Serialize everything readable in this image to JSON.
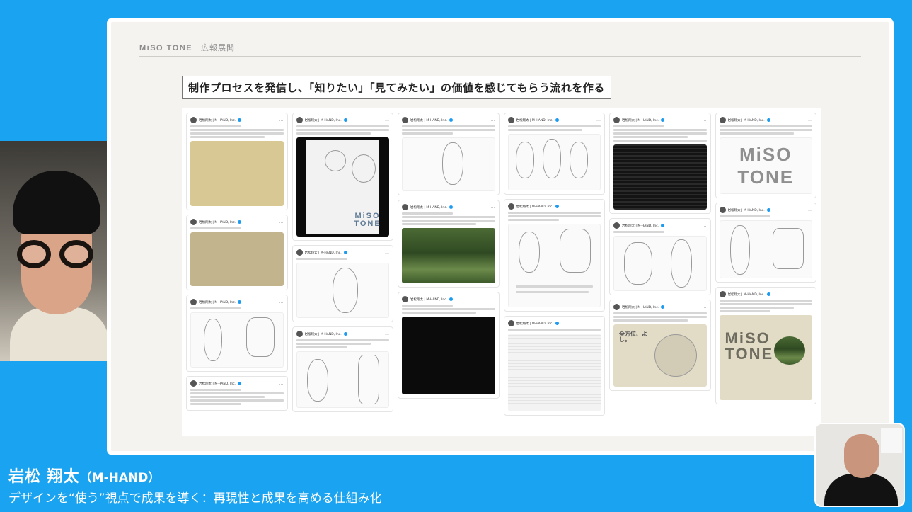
{
  "slide": {
    "brand": "MiSO TONE",
    "section": "広報展開",
    "title": "制作プロセスを発信し、「知りたい」「見てみたい」の価値を感じてもらう流れを作る"
  },
  "posts": {
    "author": "岩松翔太 | M-HAND, Inc.",
    "wordmark_1": "MiSO TONE",
    "wordmark_2": "MiSO",
    "wordmark_3": "TONE",
    "poster_word": "MiSO TONE",
    "poster_note": "全方位、よし。"
  },
  "speaker": {
    "name": "岩松 翔太",
    "org": "（M-HAND）",
    "subtitle": "デザインを“使う”視点で成果を導く：再現性と成果を高める仕組み化"
  }
}
